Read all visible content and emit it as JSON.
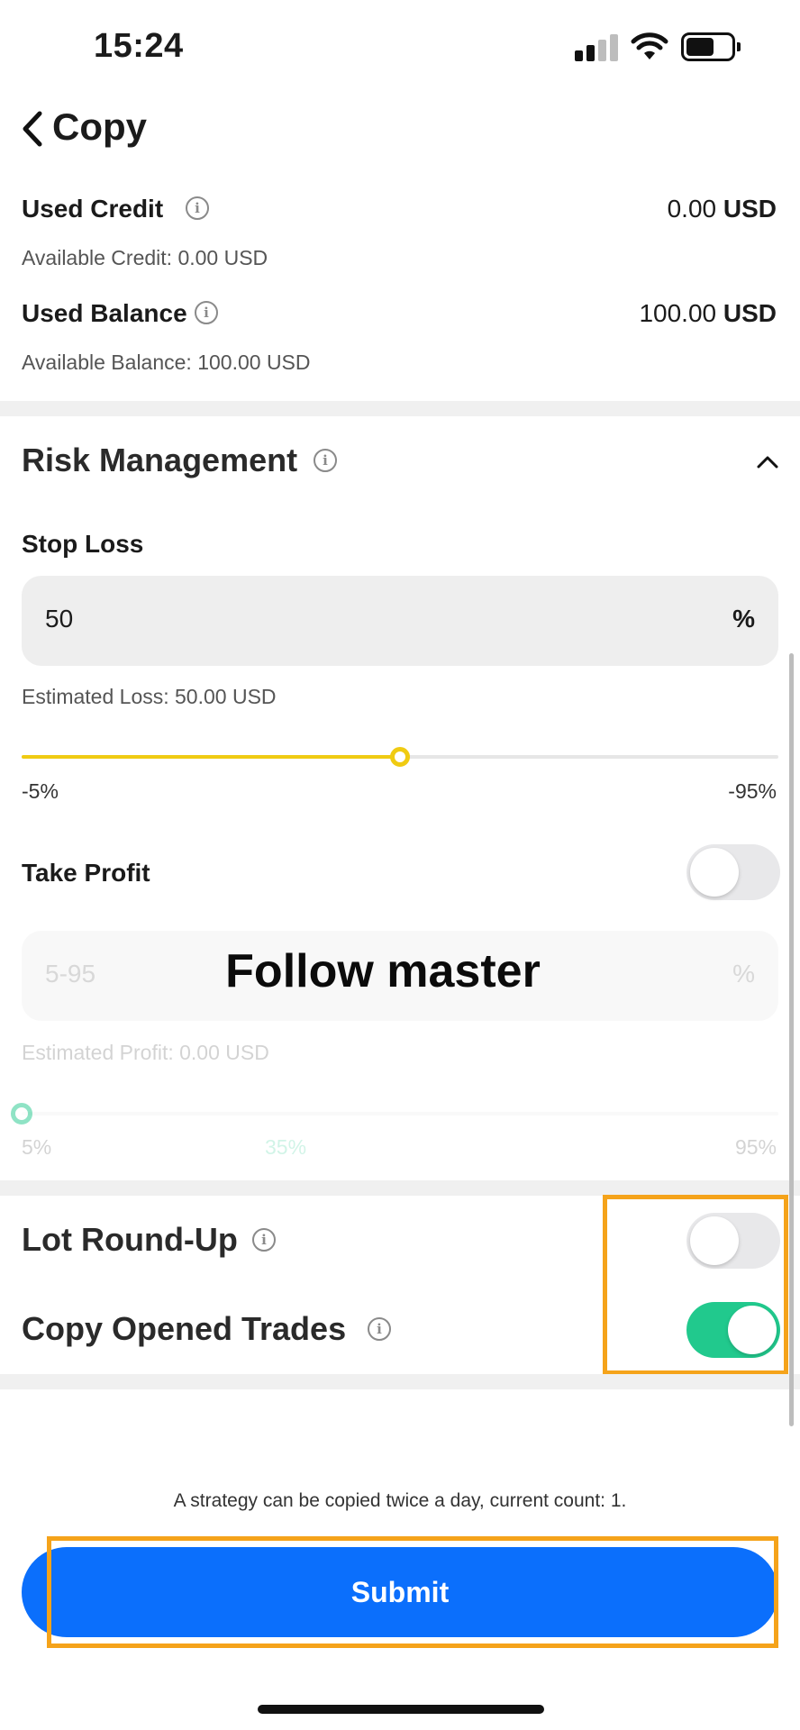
{
  "status_bar": {
    "time": "15:24",
    "signal_icon": "cellular-signal-icon",
    "wifi_icon": "wifi-icon",
    "battery_icon": "battery-icon"
  },
  "nav": {
    "back_icon": "chevron-left-icon",
    "title": "Copy"
  },
  "credit": {
    "label": "Used Credit",
    "value": "0.00",
    "unit": "USD",
    "available": "Available Credit: 0.00 USD"
  },
  "balance": {
    "label": "Used Balance",
    "value": "100.00",
    "unit": "USD",
    "available": "Available Balance: 100.00 USD"
  },
  "risk": {
    "title": "Risk Management",
    "stop_loss": {
      "label": "Stop Loss",
      "value": "50",
      "unit": "%",
      "estimate": "Estimated Loss: 50.00 USD",
      "slider_min_label": "-5%",
      "slider_max_label": "-95%",
      "slider_fraction": 0.5
    },
    "take_profit": {
      "label": "Take Profit",
      "enabled": false,
      "placeholder": "5-95",
      "unit": "%",
      "estimate": "Estimated Profit: 0.00 USD",
      "slider_min_label": "5%",
      "slider_mid_label": "35%",
      "slider_max_label": "95%"
    }
  },
  "annotation_overlay": "Follow master",
  "options": {
    "lot_round_up": {
      "label": "Lot Round-Up",
      "enabled": false
    },
    "copy_opened_trades": {
      "label": "Copy Opened Trades",
      "enabled": true
    }
  },
  "footnote": "A strategy can be copied twice a day, current count: 1.",
  "submit_label": "Submit",
  "colors": {
    "accent_yellow": "#f0cb12",
    "toggle_on": "#21c98d",
    "primary_button": "#0b6ffc",
    "highlight_box": "#f5a31a"
  }
}
